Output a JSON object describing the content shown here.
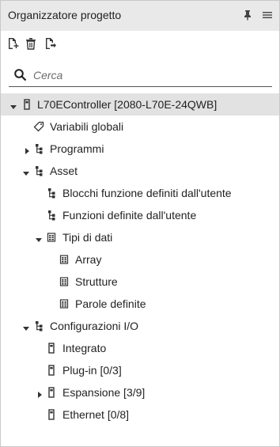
{
  "header": {
    "title": "Organizzatore progetto"
  },
  "search": {
    "placeholder": "Cerca",
    "value": ""
  },
  "tree": {
    "controller": "L70EController [2080-L70E-24QWB]",
    "globals": "Variabili globali",
    "programs": "Programmi",
    "assets": "Asset",
    "udfb": "Blocchi funzione definiti dall'utente",
    "udf": "Funzioni definite dall'utente",
    "datatypes": "Tipi di dati",
    "array": "Array",
    "structures": "Strutture",
    "words": "Parole definite",
    "io": "Configurazioni I/O",
    "embedded": "Integrato",
    "plugin": "Plug-in [0/3]",
    "expansion": "Espansione [3/9]",
    "ethernet": "Ethernet [0/8]"
  },
  "colors": {
    "header_bg": "#e9e9e9",
    "selected_bg": "#e2e2e2",
    "icon": "#333333"
  }
}
